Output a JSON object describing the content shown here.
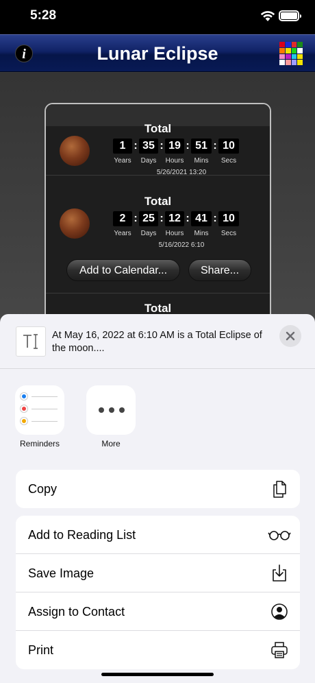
{
  "status_bar": {
    "time": "5:28"
  },
  "nav": {
    "title": "Lunar Eclipse",
    "info_label": "i"
  },
  "grid_colors": [
    "#d9001b",
    "#1a2bd6",
    "#e02a2a",
    "#1b8a1b",
    "#ff7a00",
    "#f2e200",
    "#1bd21b",
    "#ffffff",
    "#f58cc8",
    "#c01fc0",
    "#22c8e6",
    "#f2e200",
    "#ffffff",
    "#ff9a9a",
    "#9e9eff",
    "#f2e200"
  ],
  "countdown_units": [
    "Years",
    "Days",
    "Hours",
    "Mins",
    "Secs"
  ],
  "eclipses": [
    {
      "type": "Total",
      "values": [
        "1",
        "35",
        "19",
        "51",
        "10"
      ],
      "date": "5/26/2021  13:20"
    },
    {
      "type": "Total",
      "values": [
        "2",
        "25",
        "12",
        "41",
        "10"
      ],
      "date": "5/16/2022  6:10"
    },
    {
      "type": "Total"
    }
  ],
  "panel_buttons": {
    "calendar": "Add to Calendar...",
    "share": "Share..."
  },
  "share": {
    "text": "At May 16, 2022 at 6:10 AM is a Total Eclipse of the moon....",
    "apps": [
      {
        "label": "Reminders",
        "icon": "reminders-icon"
      },
      {
        "label": "More",
        "icon": "more-icon"
      }
    ],
    "actions_group1": [
      {
        "label": "Copy",
        "icon": "copy-icon"
      }
    ],
    "actions_group2": [
      {
        "label": "Add to Reading List",
        "icon": "glasses-icon"
      },
      {
        "label": "Save Image",
        "icon": "save-icon"
      },
      {
        "label": "Assign to Contact",
        "icon": "contact-icon"
      },
      {
        "label": "Print",
        "icon": "printer-icon"
      }
    ]
  },
  "colors": {
    "reminder_dots": [
      "#1a7ff0",
      "#ef4444",
      "#f2a900"
    ]
  }
}
